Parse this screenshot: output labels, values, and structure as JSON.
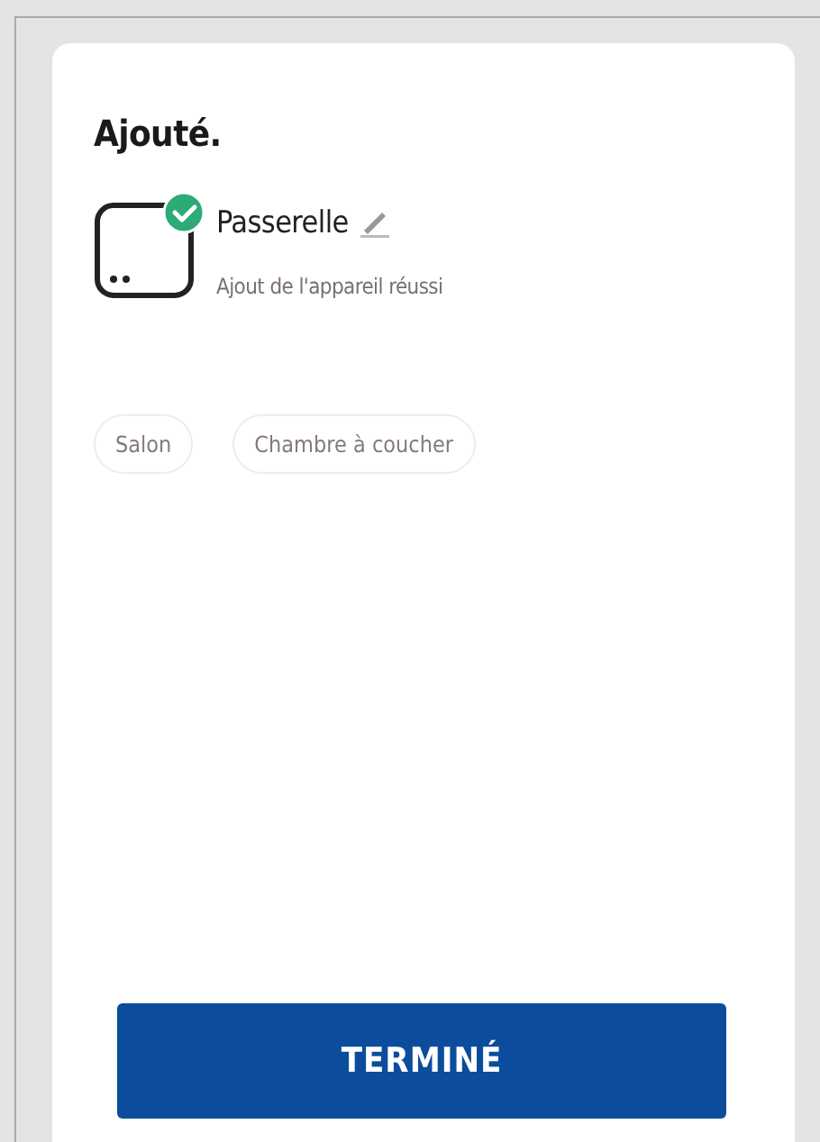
{
  "title": "Ajouté.",
  "device": {
    "name": "Passerelle",
    "status": "Ajout de l'appareil réussi"
  },
  "rooms": [
    {
      "label": "Salon"
    },
    {
      "label": "Chambre à coucher"
    }
  ],
  "button": "TERMINÉ"
}
